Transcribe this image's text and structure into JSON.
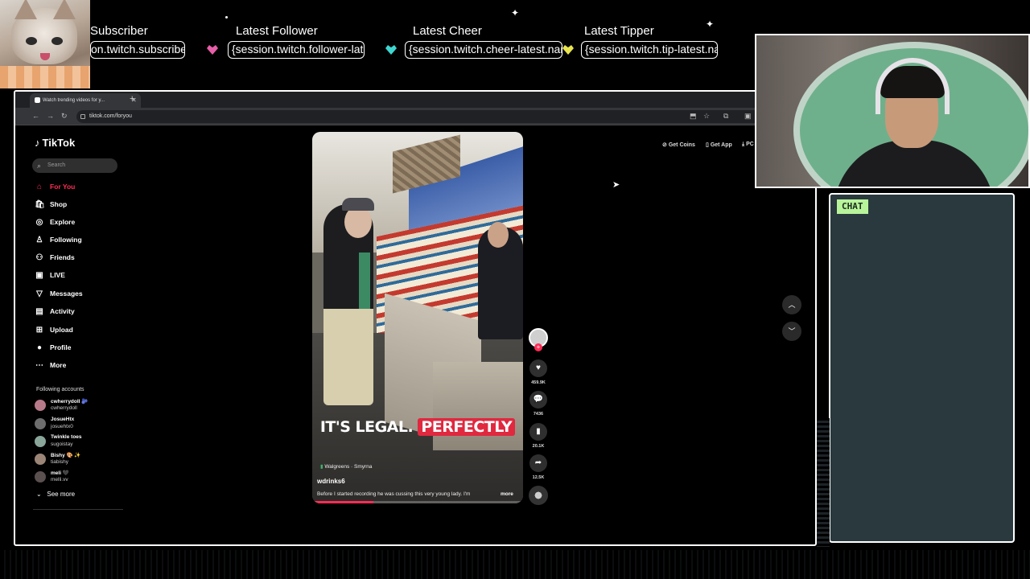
{
  "stream_alerts": {
    "subscriber": {
      "title": "Subscriber",
      "value": "on.twitch.subscriber-latest"
    },
    "follower": {
      "title": "Latest Follower",
      "value": "{session.twitch.follower-latest.name}"
    },
    "cheer": {
      "title": "Latest Cheer",
      "value": "{session.twitch.cheer-latest.name}"
    },
    "tipper": {
      "title": "Latest Tipper",
      "value": "{session.twitch.tip-latest.name}"
    }
  },
  "browser": {
    "tab_title": "Watch trending videos for y...",
    "url": "tiktok.com/foryou"
  },
  "tiktok": {
    "brand": "TikTok",
    "search_placeholder": "Search",
    "nav": [
      {
        "label": "For You",
        "icon": "home-icon"
      },
      {
        "label": "Shop",
        "icon": "shop-icon"
      },
      {
        "label": "Explore",
        "icon": "compass-icon"
      },
      {
        "label": "Following",
        "icon": "following-icon"
      },
      {
        "label": "Friends",
        "icon": "friends-icon"
      },
      {
        "label": "LIVE",
        "icon": "live-icon"
      },
      {
        "label": "Messages",
        "icon": "messages-icon"
      },
      {
        "label": "Activity",
        "icon": "activity-icon"
      },
      {
        "label": "Upload",
        "icon": "upload-icon"
      },
      {
        "label": "Profile",
        "icon": "profile-avatar"
      },
      {
        "label": "More",
        "icon": "more-icon"
      }
    ],
    "following_header": "Following accounts",
    "accounts": [
      {
        "name": "cwherrydoll 🫐",
        "handle": "cwherrydoll"
      },
      {
        "name": "JosueHtx",
        "handle": "josuehtx0"
      },
      {
        "name": "Twinkle toes",
        "handle": "sugoistay"
      },
      {
        "name": "Bishy 🎨 ✨",
        "handle": "tiabishy"
      },
      {
        "name": "meli 🖤",
        "handle": "melli.vv"
      }
    ],
    "see_more": "See more",
    "top_actions": {
      "coins": "Get Coins",
      "app": "Get App",
      "pc": "PC"
    },
    "video": {
      "caption_a": "IT'S LEGAL.",
      "caption_b": "PERFECTLY",
      "location": "Walgreens · Smyrna",
      "username": "wdrinks6",
      "description": "Before I started recording he was cussing this very young lady. I'm",
      "more": "more",
      "progress": 0.29
    },
    "stats": {
      "likes": "459.9K",
      "comments": "7436",
      "saves": "20.1K",
      "shares": "12.5K"
    }
  },
  "chat": {
    "label": "CHAT"
  },
  "colors": {
    "tiktok_red": "#fe2c55",
    "chat_bg": "#29393d",
    "chat_label": "#b8f49a"
  }
}
